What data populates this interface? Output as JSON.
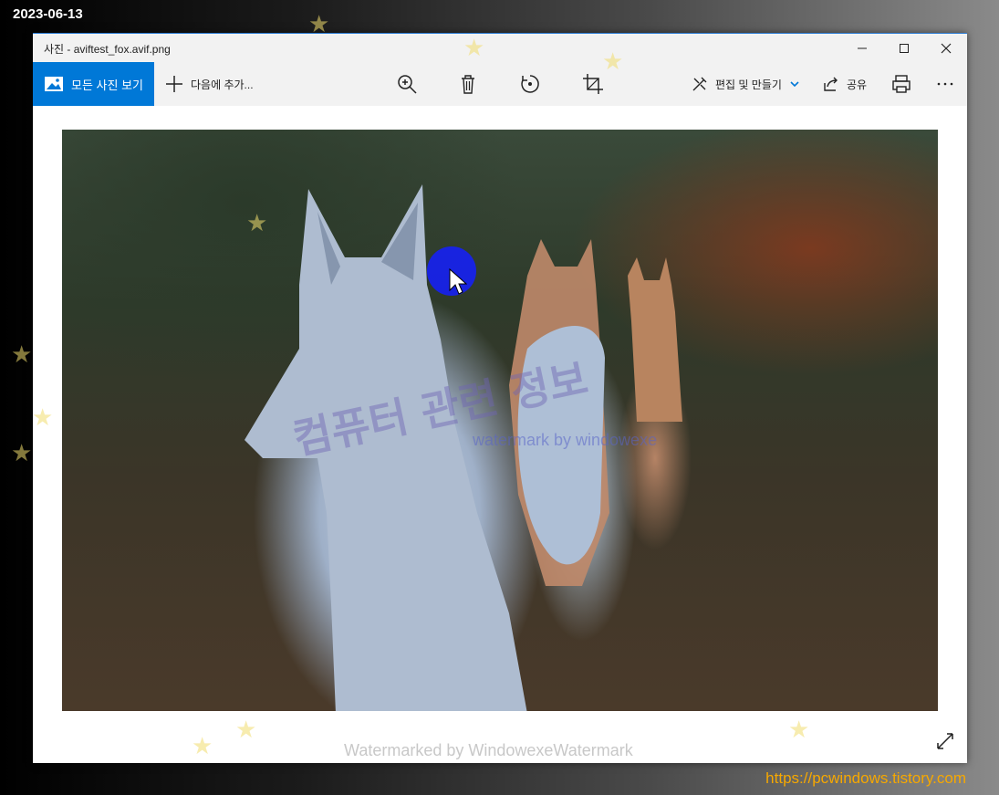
{
  "overlay": {
    "date": "2023-06-13",
    "site_url": "https://pcwindows.tistory.com"
  },
  "window": {
    "title": "사진 - aviftest_fox.avif.png",
    "controls": {
      "minimize_icon": "minimize-icon",
      "maximize_icon": "maximize-icon",
      "close_icon": "close-icon"
    }
  },
  "toolbar": {
    "all_photos_label": "모든 사진 보기",
    "add_to_label": "다음에 추가...",
    "edit_create_label": "편집 및 만들기",
    "share_label": "공유",
    "icons": [
      "zoom-icon",
      "delete-icon",
      "rotate-icon",
      "crop-icon",
      "print-icon",
      "more-icon"
    ]
  },
  "image": {
    "watermark_korean": "컴퓨터 관련 정보",
    "watermark_english": "watermark by windowexe"
  },
  "footer": {
    "watermark": "Watermarked by WindowexeWatermark"
  },
  "colors": {
    "accent": "#0078d7",
    "titlebar_bg": "#f2f2f2",
    "url_color": "#f6a800"
  }
}
